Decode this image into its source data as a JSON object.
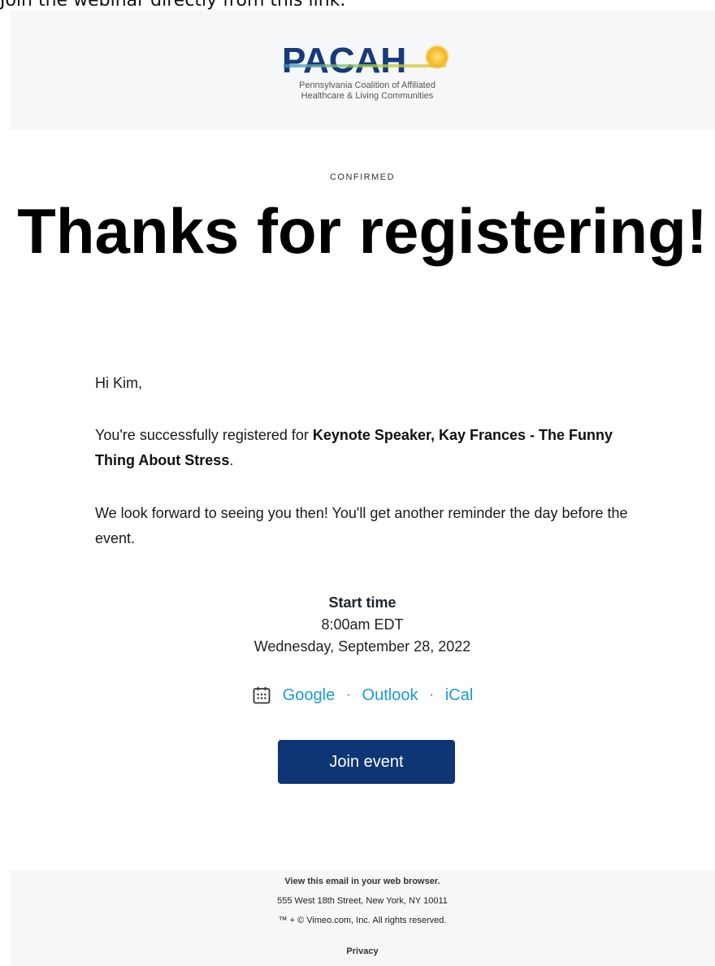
{
  "top_text": "Join the webinar directly from this link.",
  "header": {
    "logo_word": "PACAH",
    "logo_line1": "Pennsylvania Coalition of Affiliated",
    "logo_line2": "Healthcare & Living Communities",
    "brand_color": "#163a7a"
  },
  "main": {
    "eyebrow": "CONFIRMED",
    "title": "Thanks for registering!",
    "greeting": "Hi Kim,",
    "registered_prefix": "You're successfully registered for ",
    "event_name": "Keynote Speaker, Kay Frances - The Funny Thing About Stress",
    "registered_suffix": ".",
    "reminder": "We look forward to seeing you then! You'll get another reminder the day before the event."
  },
  "start": {
    "label": "Start time",
    "time": "8:00am EDT",
    "date": "Wednesday, September 28, 2022"
  },
  "calendar": {
    "icon": "calendar-icon",
    "links": [
      "Google",
      "Outlook",
      "iCal"
    ],
    "separator": "·",
    "link_color": "#1a9bd7"
  },
  "join_button": {
    "label": "Join event",
    "color": "#0e3574"
  },
  "footer": {
    "browser_link": "View this email in your web browser.",
    "address": "555 West 18th Street, New York, NY 10011",
    "copyright": "™ + © Vimeo.com, Inc. All rights reserved.",
    "privacy": "Privacy"
  }
}
